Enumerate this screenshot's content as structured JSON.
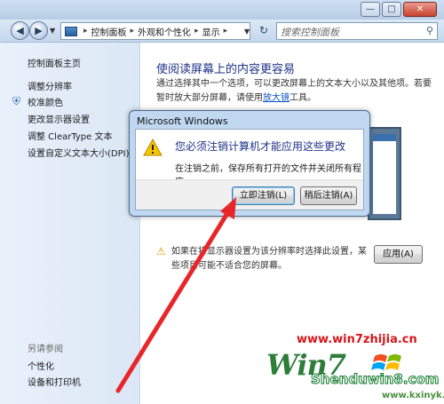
{
  "window": {
    "minimize_glyph": "—",
    "maximize_glyph": "□",
    "close_glyph": "✕"
  },
  "navigation": {
    "back_glyph": "◀",
    "forward_glyph": "▶",
    "breadcrumb": [
      "控制面板",
      "外观和个性化",
      "显示"
    ],
    "breadcrumb_sep": "▸",
    "refresh_glyph": "↻",
    "search_placeholder": "搜索控制面板",
    "search_glyph": "⚲"
  },
  "sidebar": {
    "items": [
      "控制面板主页",
      "调整分辨率",
      "校准颜色",
      "更改显示器设置",
      "调整 ClearType 文本",
      "设置自定义文本大小(DPI)"
    ],
    "see_also_title": "另请参阅",
    "see_also_items": [
      "个性化",
      "设备和打印机"
    ]
  },
  "main": {
    "heading": "使阅读屏幕上的内容更容易",
    "desc_before": "通过选择其中一个选项，可以更改屏幕上的文本大小以及其他项。若要暂时放大部分屏幕，请使用",
    "desc_link": "放大镜",
    "desc_after": "工具。",
    "warning_text": "如果在将显示器设置为该分辨率时选择此设置，某些项目可能不适合您的屏幕。",
    "apply_label": "应用(A)"
  },
  "dialog": {
    "title": "Microsoft Windows",
    "main_instruction": "您必须注销计算机才能应用这些更改",
    "content": "在注销之前，保存所有打开的文件并关闭所有程序。",
    "logoff_label": "立即注销(L)",
    "later_label": "稍后注销(A)"
  },
  "watermark": {
    "url": "www.win7zhijia.cn",
    "logo": "Win7",
    "brand": "Shenduwin8.com",
    "site": "www.kxinyk.com"
  },
  "colors": {
    "arrow": "#e8262a",
    "link": "#0b52c4",
    "heading": "#1e3287"
  }
}
